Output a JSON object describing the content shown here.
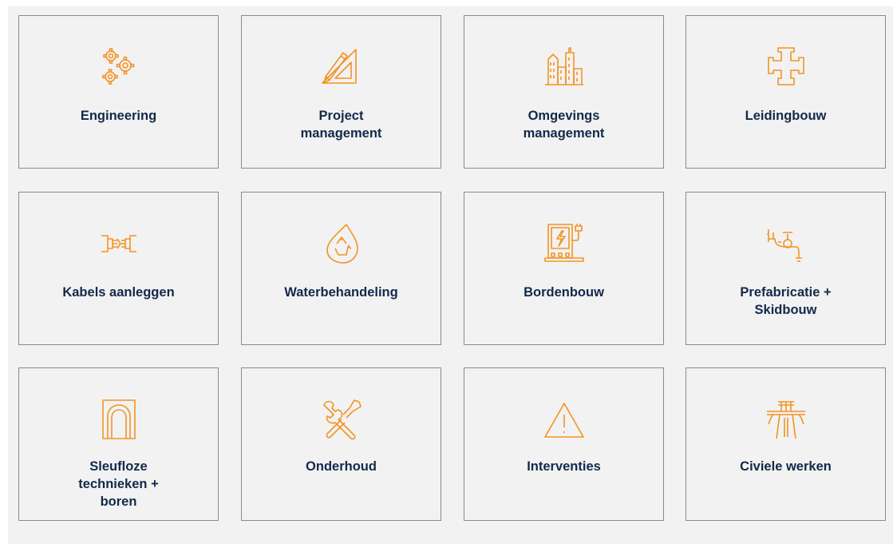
{
  "colors": {
    "icon": "#f39323",
    "label": "#13294b",
    "card_background": "#f2f2f2",
    "card_border": "#8a8a8a"
  },
  "services": [
    {
      "label": "Engineering",
      "icon": "gears-icon"
    },
    {
      "label": "Project\nmanagement",
      "icon": "pencil-triangle-icon"
    },
    {
      "label": "Omgevings\nmanagement",
      "icon": "city-buildings-icon"
    },
    {
      "label": "Leidingbouw",
      "icon": "pipe-fitting-icon"
    },
    {
      "label": "Kabels aanleggen",
      "icon": "cable-connector-icon"
    },
    {
      "label": "Waterbehandeling",
      "icon": "water-recycle-icon"
    },
    {
      "label": "Bordenbouw",
      "icon": "electrical-panel-icon"
    },
    {
      "label": "Prefabricatie +\nSkidbouw",
      "icon": "pipe-valve-icon"
    },
    {
      "label": "Sleufloze\ntechnieken +\nboren",
      "icon": "tunnel-icon"
    },
    {
      "label": "Onderhoud",
      "icon": "wrench-screwdriver-icon"
    },
    {
      "label": "Interventies",
      "icon": "warning-triangle-icon"
    },
    {
      "label": "Civiele werken",
      "icon": "highway-bridge-icon"
    }
  ]
}
